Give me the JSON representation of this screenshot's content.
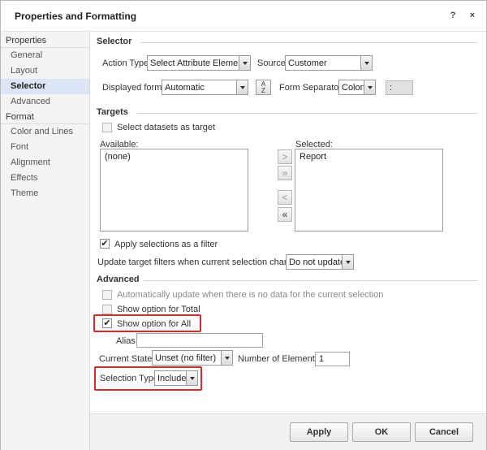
{
  "window": {
    "title": "Properties and Formatting",
    "help_label": "?",
    "close_label": "×"
  },
  "sidebar": {
    "categories": [
      {
        "label": "Properties",
        "items": [
          "General",
          "Layout",
          "Selector",
          "Advanced"
        ]
      },
      {
        "label": "Format",
        "items": [
          "Color and Lines",
          "Font",
          "Alignment",
          "Effects",
          "Theme"
        ]
      }
    ],
    "selected": "Selector"
  },
  "selector": {
    "section_title": "Selector",
    "action_type_label": "Action Type:",
    "action_type_value": "Select Attribute Element",
    "source_label": "Source:",
    "source_value": "Customer",
    "displayed_forms_label": "Displayed forms:",
    "displayed_forms_value": "Automatic",
    "sort_icon_text": "A\nZ",
    "form_separator_label": "Form Separator:",
    "form_separator_value": "Colon",
    "form_separator_preview": ":"
  },
  "targets": {
    "section_title": "Targets",
    "select_datasets_label": "Select datasets as target",
    "available_label": "Available:",
    "available_items": [
      "(none)"
    ],
    "selected_label": "Selected:",
    "selected_items": [
      "Report"
    ],
    "move_right": ">",
    "move_all_right": "»",
    "move_left": "<",
    "move_all_left": "«",
    "apply_filter_label": "Apply selections as a filter",
    "apply_filter_checked": true,
    "update_filters_label": "Update target filters when current selection changes:",
    "update_filters_value": "Do not update"
  },
  "advanced": {
    "section_title": "Advanced",
    "auto_update_label": "Automatically update when there is no data for the current selection",
    "show_total_label": "Show option for Total",
    "show_all_label": "Show option for All",
    "show_all_checked": true,
    "alias_label": "Alias:",
    "alias_value": "",
    "current_state_label": "Current State:",
    "current_state_value": "Unset (no filter)",
    "num_elements_label": "Number of Elements:",
    "num_elements_value": "1",
    "selection_type_label": "Selection Type:",
    "selection_type_value": "Include"
  },
  "footer": {
    "apply_label": "Apply",
    "ok_label": "OK",
    "cancel_label": "Cancel"
  },
  "colors": {
    "highlight": "#d72b2b",
    "selected_nav": "#dbe7f6"
  }
}
